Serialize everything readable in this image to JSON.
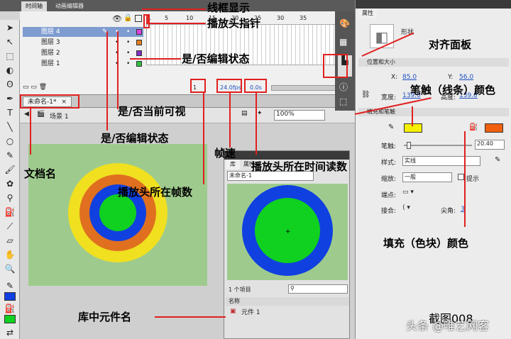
{
  "timeline": {
    "tab_timeline": "时间轴",
    "tab_motion": "动画编辑器",
    "frame_numbers": [
      "1",
      "5",
      "10",
      "15",
      "20",
      "25",
      "30",
      "35"
    ],
    "layers": [
      {
        "name": "图层 4",
        "color": "#e040e0",
        "selected": true
      },
      {
        "name": "图层 3",
        "color": "#e08020",
        "selected": false
      },
      {
        "name": "图层 2",
        "color": "#8030c0",
        "selected": false
      },
      {
        "name": "图层 1",
        "color": "#30c040",
        "selected": false
      }
    ],
    "current_frame": "1",
    "fps": "24.0",
    "fps_unit": "fps",
    "elapsed": "0.0",
    "elapsed_unit": "s"
  },
  "document": {
    "tab_label": "未命名-1*",
    "close_glyph": "×",
    "scene_label": "场景 1",
    "zoom": "100%",
    "colors": {
      "outer": "#f0e020",
      "ring1": "#e07020",
      "ring2": "#1040e0",
      "center": "#10d020",
      "stage": "#9ecb8d"
    }
  },
  "library": {
    "tab_label": "库",
    "tab_two": "属性",
    "doc_select": "未命名-1",
    "item_count": "1 个项目",
    "col_name": "名称",
    "item_name": "元件 1"
  },
  "properties": {
    "panel_title": "属性",
    "shape_label": "形状",
    "section_position": "位置和大小",
    "x_label": "X:",
    "x_value": "85.0",
    "y_label": "Y:",
    "y_value": "56.0",
    "w_label": "宽度:",
    "w_value": "139.0",
    "h_label": "高度:",
    "h_value": "139.0",
    "section_fill": "填充和笔触",
    "stroke_color": "#f6f000",
    "fill_color": "#f06010",
    "stroke_label": "笔触:",
    "stroke_value": "20.40",
    "style_label": "样式:",
    "style_value": "实线",
    "scale_label": "缩放:",
    "scale_value": "一般",
    "hint_label": "提示",
    "cap_label": "端点:",
    "join_label": "接合:",
    "miter_label": "尖角:",
    "miter_value": "3"
  },
  "annotations": {
    "outline": "线框显示",
    "playhead": "播放头指针",
    "edit_state_top": "是/否编辑状态",
    "align_panel": "对齐面板",
    "stroke_color": "笔触（线条）颜色",
    "visible": "是/否当前可视",
    "edit_state_mid": "是/否编辑状态",
    "frame_rate": "帧速",
    "doc_name": "文档名",
    "playhead_time": "播放头所在时间读数",
    "playhead_frame": "播放头所在帧数",
    "fill_color": "填充（色块）颜色",
    "symbol_name": "库中元件名",
    "screenshot_no": "截图008",
    "watermark": "头条 @唯艺网客"
  }
}
